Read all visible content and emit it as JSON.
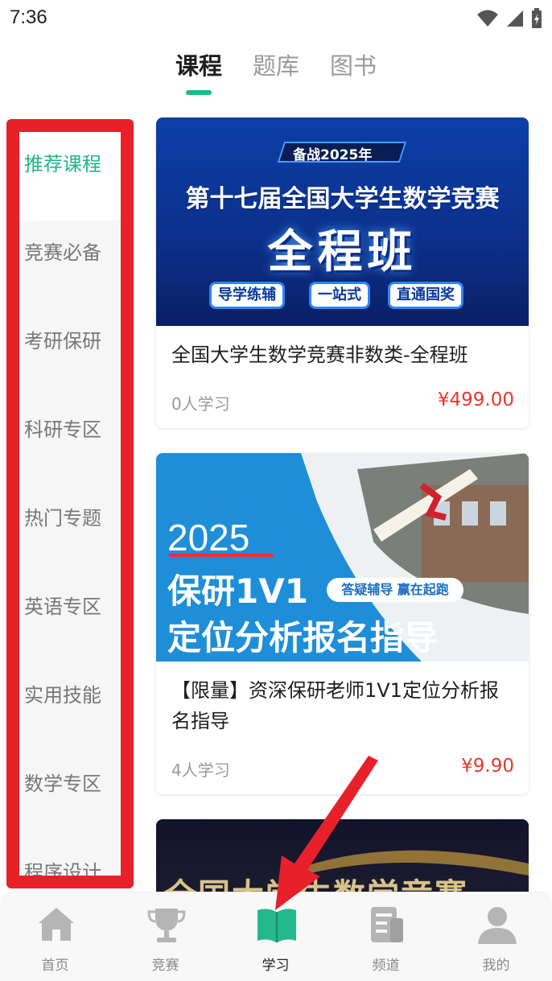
{
  "status_bar": {
    "time": "7:36"
  },
  "top_tabs": [
    {
      "label": "课程",
      "active": true
    },
    {
      "label": "题库",
      "active": false
    },
    {
      "label": "图书",
      "active": false
    }
  ],
  "categories": [
    {
      "label": "推荐课程",
      "active": true
    },
    {
      "label": "竞赛必备",
      "active": false
    },
    {
      "label": "考研保研",
      "active": false
    },
    {
      "label": "科研专区",
      "active": false
    },
    {
      "label": "热门专题",
      "active": false
    },
    {
      "label": "英语专区",
      "active": false
    },
    {
      "label": "实用技能",
      "active": false
    },
    {
      "label": "数学专区",
      "active": false
    },
    {
      "label": "程序设计",
      "active": false
    }
  ],
  "courses": [
    {
      "banner": {
        "tag": "备战2025年",
        "headline": "第十七届全国大学生数学竞赛",
        "big": "全程班",
        "pills": [
          "导学练辅",
          "一站式",
          "直通国奖"
        ]
      },
      "title": "全国大学生数学竞赛非数类-全程班",
      "learners": "0人学习",
      "price": "¥499.00"
    },
    {
      "banner": {
        "year": "2025",
        "line1": "保研1V1",
        "line2": "定位分析报名指导",
        "badge": "答疑辅导 赢在起跑"
      },
      "title": "【限量】资深保研老师1V1定位分析报名指导",
      "learners": "4人学习",
      "price": "¥9.90"
    },
    {
      "banner": {
        "partial_text": "全国大学生数学竞赛"
      }
    }
  ],
  "bottom_nav": [
    {
      "label": "首页",
      "icon": "home-icon",
      "active": false
    },
    {
      "label": "竞赛",
      "icon": "trophy-icon",
      "active": false
    },
    {
      "label": "学习",
      "icon": "book-icon",
      "active": true
    },
    {
      "label": "频道",
      "icon": "channel-icon",
      "active": false
    },
    {
      "label": "我的",
      "icon": "profile-icon",
      "active": false
    }
  ],
  "colors": {
    "accent": "#1fb88a",
    "price": "#e33a2c",
    "annotation": "#e8202a"
  }
}
